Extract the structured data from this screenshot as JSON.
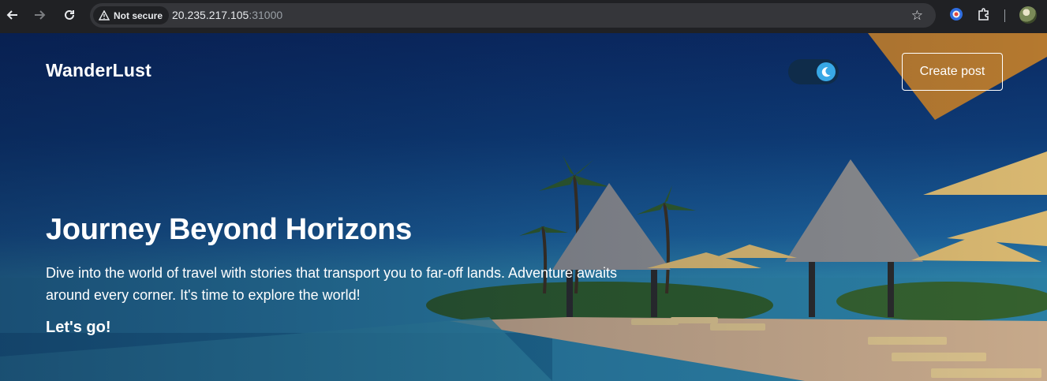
{
  "browser": {
    "security_label": "Not secure",
    "url_host": "20.235.217.105",
    "url_port": ":31000"
  },
  "site": {
    "brand": "WanderLust",
    "create_post_label": "Create post",
    "theme_toggle": {
      "state": "dark"
    }
  },
  "hero": {
    "title": "Journey Beyond Horizons",
    "subtitle": "Dive into the world of travel with stories that transport you to far-off lands. Adventure awaits around every corner. It's time to explore the world!",
    "cta": "Let's go!"
  },
  "icons": {
    "back": "back-arrow-icon",
    "forward": "forward-arrow-icon",
    "reload": "reload-icon",
    "warning": "warning-icon",
    "bookmark": "star-icon",
    "extension1": "shield-extension-icon",
    "extensions": "puzzle-icon",
    "theme": "moon-icon"
  },
  "colors": {
    "toolbar": "#202124",
    "omnibox": "#35363a",
    "toggle_track": "#0f2c4a",
    "toggle_knob": "#38a8e6"
  }
}
